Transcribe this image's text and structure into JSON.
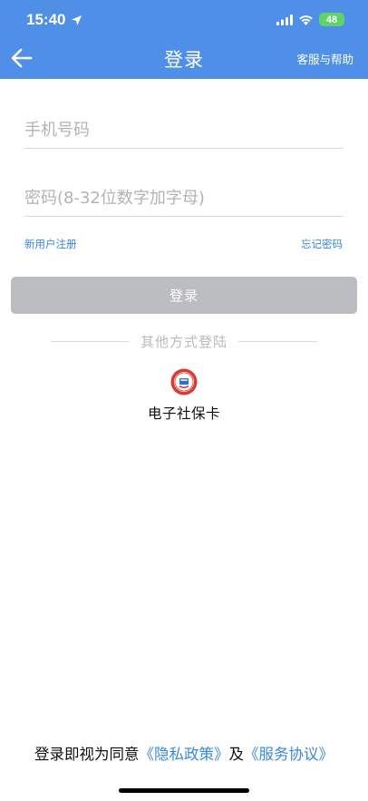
{
  "status_bar": {
    "time": "15:40",
    "battery": "48"
  },
  "nav": {
    "title": "登录",
    "help": "客服与帮助"
  },
  "form": {
    "phone_placeholder": "手机号码",
    "password_placeholder": "密码(8-32位数字加字母)",
    "register_link": "新用户注册",
    "forgot_link": "忘记密码",
    "login_button": "登录"
  },
  "alt_login": {
    "divider_label": "其他方式登陆",
    "option_label": "电子社保卡"
  },
  "agreement": {
    "prefix": "登录即视为同意",
    "privacy": "《隐私政策》",
    "joiner": "及",
    "service": "《服务协议》"
  },
  "colors": {
    "header": "#4f8fe8",
    "link": "#3a86df",
    "disabled_button": "#bcbdc0"
  }
}
